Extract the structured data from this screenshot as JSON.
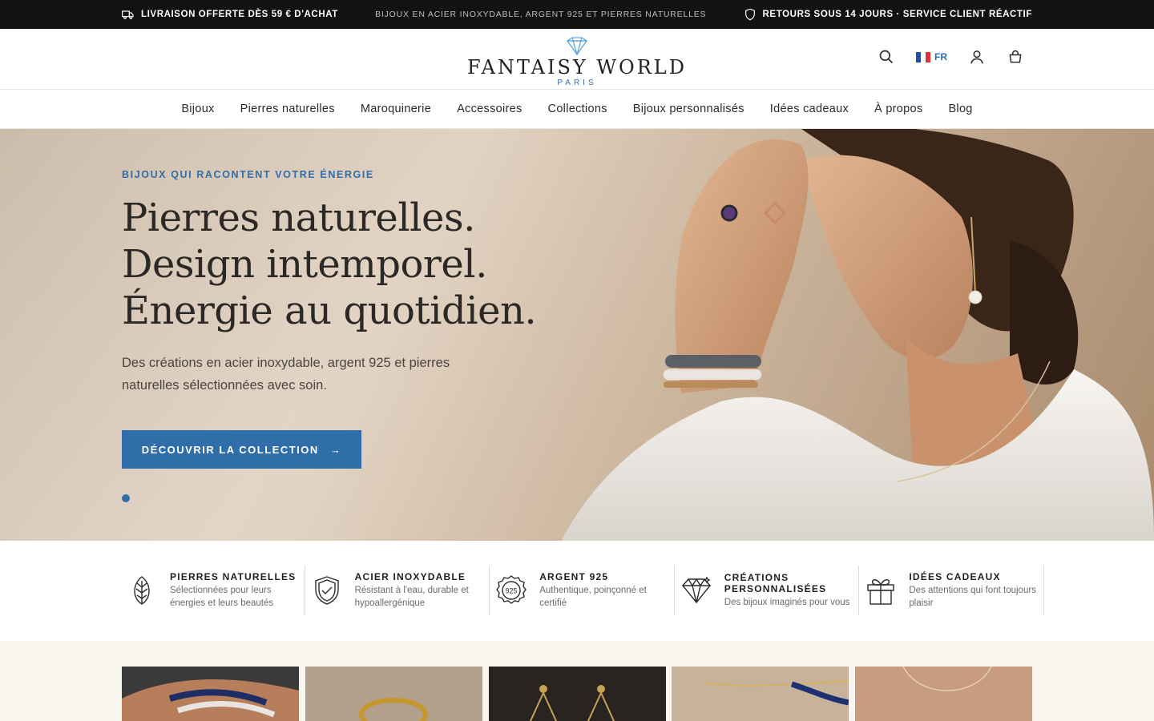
{
  "topbar": {
    "left": "LIVRAISON OFFERTE DÈS 59 € D'ACHAT",
    "center": "BIJOUX EN ACIER INOXYDABLE, ARGENT 925 ET PIERRES NATURELLES",
    "right": "RETOURS SOUS 14 JOURS · SERVICE CLIENT RÉACTIF"
  },
  "header": {
    "brand": "FANTAISY WORLD",
    "city": "PARIS",
    "language": "FR",
    "icons": [
      "search-icon",
      "flag-fr-icon",
      "user-icon",
      "bag-icon"
    ]
  },
  "nav": {
    "items": [
      "Bijoux",
      "Pierres naturelles",
      "Maroquinerie",
      "Accessoires",
      "Collections",
      "Bijoux personnalisés",
      "Idées cadeaux",
      "À propos",
      "Blog"
    ]
  },
  "hero": {
    "eyebrow": "BIJOUX QUI RACONTENT VOTRE ÉNERGIE",
    "title_line1": "Pierres naturelles.",
    "title_line2": "Design intemporel.",
    "title_line3": "Énergie au quotidien.",
    "subtitle": "Des créations en acier inoxydable, argent 925 et pierres naturelles sélectionnées avec soin.",
    "cta": "DÉCOUVRIR LA COLLECTION",
    "cta_arrow": "→"
  },
  "features": [
    {
      "icon": "leaf-icon",
      "title": "PIERRES NATURELLES",
      "desc": "Sélectionnées pour leurs énergies et leurs beautés"
    },
    {
      "icon": "shield-check-icon",
      "title": "ACIER INOXYDABLE",
      "desc": "Résistant à l'eau, durable et hypoallergénique"
    },
    {
      "icon": "hallmark-925-icon",
      "title": "ARGENT 925",
      "desc": "Authentique, poinçonné et certifié",
      "badge": "925"
    },
    {
      "icon": "diamond-icon",
      "title": "CRÉATIONS PERSONNALISÉES",
      "desc": "Des bijoux imaginés pour vous"
    },
    {
      "icon": "gift-icon",
      "title": "IDÉES CADEAUX",
      "desc": "Des attentions qui font toujours plaisir"
    }
  ],
  "colors": {
    "accent": "#2f6ea9",
    "topbar_bg": "#121212",
    "hero_bg": "#e2d3c3",
    "products_bg": "#f8f4ee"
  }
}
